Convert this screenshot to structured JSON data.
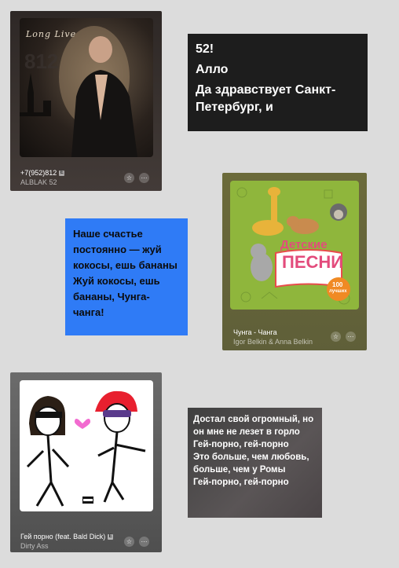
{
  "cards": [
    {
      "title": "+7(952)812",
      "artist": "ALBLAK 52",
      "explicit_mark": "E",
      "cover_text": "Long Live",
      "cover_number": "812",
      "star_icon": "☆",
      "more_icon": "···"
    },
    {
      "title": "Чунга - Чанга",
      "artist": "Igor Belkin & Anna Belkin",
      "cover_title_1": "Детские",
      "cover_title_2": "песни",
      "cover_badge_1": "100",
      "cover_badge_2": "лучших",
      "star_icon": "☆",
      "more_icon": "···"
    },
    {
      "title": "Гей порно (feat. Bald Dick)",
      "artist": "Dirty Ass",
      "explicit_mark": "E",
      "star_icon": "☆",
      "more_icon": "···"
    }
  ],
  "lyrics": [
    {
      "lines": [
        "52!",
        "Алло",
        "Да здравствует Санкт-Петербург, и"
      ],
      "colors": {
        "bg": "#1b1b1b",
        "text": "#ffffff"
      }
    },
    {
      "lines": [
        "Наше счастье постоянно — жуй кокосы, ешь бананы",
        "Жуй кокосы, ешь бананы, Чунга-чанга!"
      ],
      "colors": {
        "bg": "#2f7bf6",
        "text": "#0b0b0b"
      }
    },
    {
      "lines": [
        "Достал свой огромный, но он мне не лезет в горло",
        "Гей-порно, гей-порно",
        "Это больше, чем любовь, больше, чем у Ромы",
        "Гей-порно, гей-порно"
      ],
      "colors": {
        "bg": "#4a4a4a",
        "text": "#ffffff"
      }
    }
  ],
  "colors": {
    "page_bg": "#dcdcdc",
    "card1_bg": "#3b3432",
    "card2_bg": "#6a6a3c",
    "card3_bg": "#5a5a5a"
  }
}
